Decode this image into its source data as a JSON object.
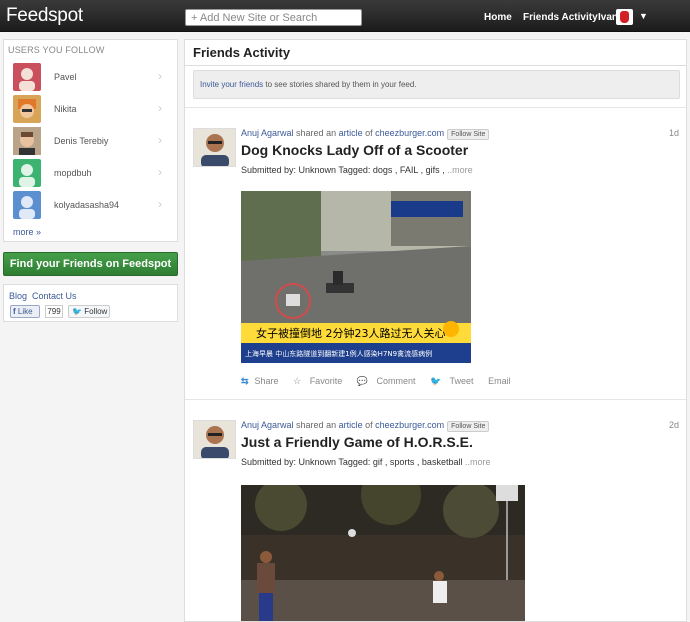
{
  "app": {
    "logo": "Feedspot"
  },
  "search": {
    "placeholder": "+ Add New Site or Search"
  },
  "nav": {
    "home": "Home",
    "friends": "Friends Activity",
    "user": "Ivan"
  },
  "sidebar": {
    "title": "USERS YOU FOLLOW",
    "users": [
      {
        "name": "Pavel",
        "color": "#c9505c"
      },
      {
        "name": "Nikita",
        "color": "#d8a458"
      },
      {
        "name": "Denis Terebiy",
        "color": "#8a6a50"
      },
      {
        "name": "mopdbuh",
        "color": "#3cb371"
      },
      {
        "name": "kolyadasasha94",
        "color": "#5b8fd0"
      }
    ],
    "more": "more »"
  },
  "find_friends": {
    "label": "Find your Friends on Feedspot"
  },
  "social": {
    "blog": "Blog",
    "contact": "Contact Us",
    "like": "Like",
    "like_count": "799",
    "follow": "Follow"
  },
  "main": {
    "title": "Friends Activity",
    "invite_link": "Invite your friends",
    "invite_rest": " to see stories shared by them in your feed."
  },
  "stories": [
    {
      "author": "Anuj Agarwal",
      "shared": " shared an ",
      "type": "article",
      "of": " of ",
      "site": "cheezburger.com",
      "follow_site": "Follow Site",
      "age": "1d",
      "title": "Dog Knocks Lady Off of a Scooter",
      "submitted": "Submitted by: Unknown Tagged: dogs , FAIL , gifs , ",
      "more": "..more",
      "actions": {
        "share": "Share",
        "favorite": "Favorite",
        "comment": "Comment",
        "tweet": "Tweet",
        "email": "Email"
      },
      "image_caption": "女子被撞倒地 2分钟23人路过无人关心",
      "image_ticker": "上海早晨 中山东路隧道到翻新建1例人感染H7N9禽流感病例"
    },
    {
      "author": "Anuj Agarwal",
      "shared": " shared an ",
      "type": "article",
      "of": " of ",
      "site": "cheezburger.com",
      "follow_site": "Follow Site",
      "age": "2d",
      "title": "Just a Friendly Game of H.O.R.S.E.",
      "submitted": "Submitted by: Unknown Tagged: gif , sports , basketball ",
      "more": "..more"
    }
  ]
}
